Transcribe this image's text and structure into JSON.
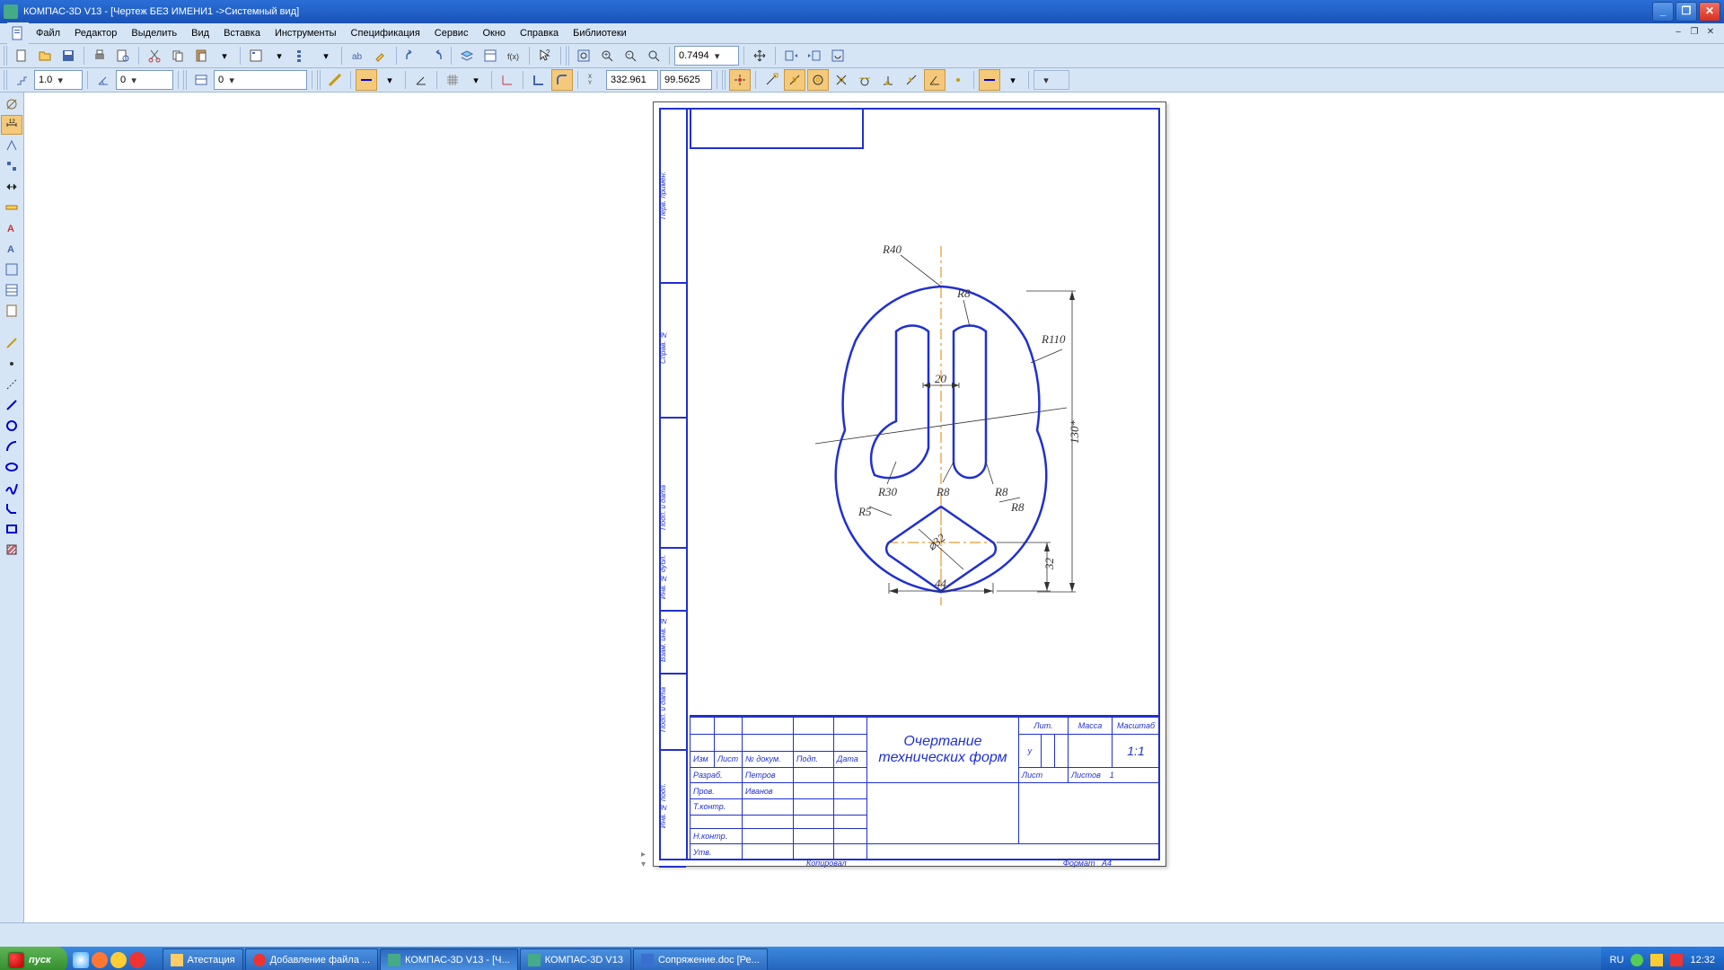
{
  "title": "КОМПАС-3D V13 - [Чертеж БЕЗ ИМЕНИ1 ->Системный вид]",
  "menu": [
    "Файл",
    "Редактор",
    "Выделить",
    "Вид",
    "Вставка",
    "Инструменты",
    "Спецификация",
    "Сервис",
    "Окно",
    "Справка",
    "Библиотеки"
  ],
  "zoom": "0.7494",
  "step": "1.0",
  "angle": "0",
  "style": "0",
  "coordX": "332.961",
  "coordY": "99.5625",
  "drawing": {
    "labels": {
      "r40": "R40",
      "r8_1": "R8",
      "r110": "R110",
      "d20": "20",
      "r30": "R30",
      "r8_2": "R8",
      "r8_3": "R8",
      "r8_4": "R8",
      "r5": "R5",
      "d32": "⌀32",
      "d44": "44",
      "h32": "32",
      "h130": "130*"
    }
  },
  "titleblock": {
    "row_hdr": [
      "Изм",
      "Лист",
      "№ докум.",
      "Подп.",
      "Дата"
    ],
    "rows": [
      [
        "Разраб.",
        "Петров"
      ],
      [
        "Пров.",
        "Иванов"
      ],
      [
        "Т.контр.",
        ""
      ],
      [
        "",
        ""
      ],
      [
        "Н.контр.",
        ""
      ],
      [
        "Утв.",
        ""
      ]
    ],
    "name_l1": "Очертание",
    "name_l2": "технических форм",
    "lit": "Лит.",
    "mass": "Масса",
    "scale": "Масштаб",
    "scale_v": "1:1",
    "litv": "у",
    "sheet": "Лист",
    "sheets": "Листов",
    "sheets_v": "1",
    "copy": "Копировал",
    "format": "Формат",
    "format_v": "А4"
  },
  "leftstrip": [
    "Перв. примен.",
    "Справ. №",
    "Подп. и дата",
    "Инв. № дубл.",
    "Взам. инв. №",
    "Подп. и дата",
    "Инв. № подп."
  ],
  "taskbar": {
    "start": "пуск",
    "items": [
      "Атестация",
      "Добавление файла ...",
      "КОМПАС-3D V13 - [Ч...",
      "КОМПАС-3D V13",
      "Сопряжение.doc [Ре..."
    ],
    "lang": "RU",
    "time": "12:32"
  }
}
